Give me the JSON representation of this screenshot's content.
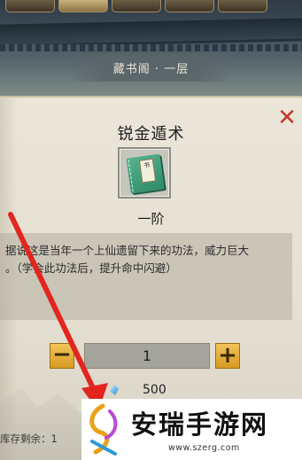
{
  "location": {
    "title": "藏书阁 · 一层"
  },
  "dialog": {
    "close_symbol": "✕",
    "skill_name": "锐金遁术",
    "book_icon_text": "书",
    "skill_rank": "一阶",
    "description_line1": "据说这是当年一个上仙遗留下来的功法，威力巨大",
    "description_line2": "。（学会此功法后，提升命中闪避）",
    "quantity": {
      "minus_label": "−",
      "plus_label": "+",
      "value": "1"
    },
    "price": {
      "currency_icon": "gem-icon",
      "value": "500"
    },
    "stock_label": "库存剩余：1"
  },
  "watermark": {
    "title": "安瑞手游网",
    "url": "www.szerg.com"
  },
  "colors": {
    "close": "#c5372b",
    "button_gold": "#e6ad37",
    "arrow": "#e2261f",
    "book_green": "#3f9d78"
  }
}
